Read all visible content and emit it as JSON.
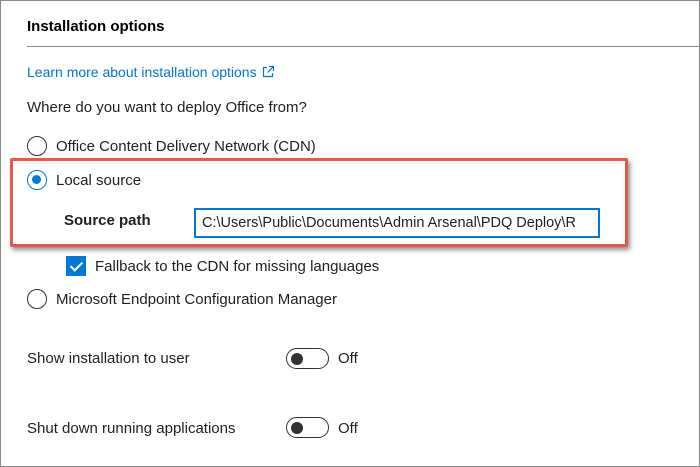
{
  "section": {
    "title": "Installation options",
    "learn_more": "Learn more about installation options"
  },
  "deploy": {
    "question": "Where do you want to deploy Office from?",
    "options": [
      {
        "label": "Office Content Delivery Network (CDN)",
        "selected": false
      },
      {
        "label": "Local source",
        "selected": true
      },
      {
        "label": "Microsoft Endpoint Configuration Manager",
        "selected": false
      }
    ],
    "source_path_label": "Source path",
    "source_path_value": "C:\\Users\\Public\\Documents\\Admin Arsenal\\PDQ Deploy\\R",
    "fallback_label": "Fallback to the CDN for missing languages",
    "fallback_checked": true
  },
  "toggles": [
    {
      "label": "Show installation to user",
      "state": "Off"
    },
    {
      "label": "Shut down running applications",
      "state": "Off"
    }
  ],
  "colors": {
    "accent": "#0078d4",
    "highlight": "#e8574e",
    "text": "#201f1e"
  }
}
